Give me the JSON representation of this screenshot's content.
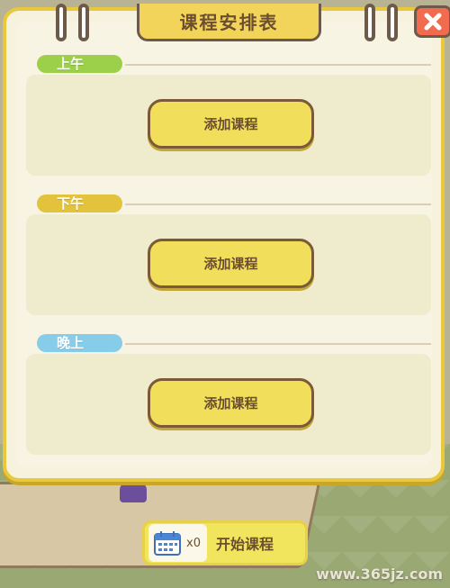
{
  "panel": {
    "title": "课程安排表",
    "close_icon": "close-icon"
  },
  "sections": [
    {
      "label": "上午",
      "label_color": "#9ccf4a",
      "button": "添加课程"
    },
    {
      "label": "下午",
      "label_color": "#e3c23c",
      "button": "添加课程"
    },
    {
      "label": "晚上",
      "label_color": "#87cdea",
      "button": "添加课程"
    }
  ],
  "start": {
    "icon": "calendar-icon",
    "count": "x0",
    "label": "开始课程"
  },
  "watermark": "www.365jz.com",
  "colors": {
    "accent": "#f3d45a",
    "outline": "#6e5a4a",
    "close": "#f36b4f"
  }
}
